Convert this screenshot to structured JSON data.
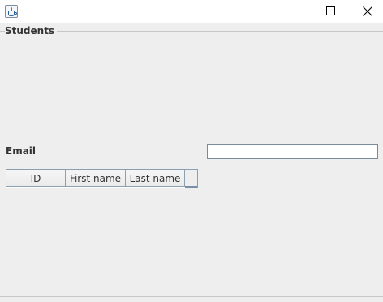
{
  "window": {
    "title": "",
    "app_icon": "java-cup-icon",
    "controls": [
      "minimize-icon",
      "maximize-icon",
      "close-icon"
    ]
  },
  "form": {
    "group_title": "Students",
    "email_label": "Email",
    "email_value": ""
  },
  "table": {
    "columns": [
      "ID",
      "First name",
      "Last name"
    ],
    "rows": []
  }
}
